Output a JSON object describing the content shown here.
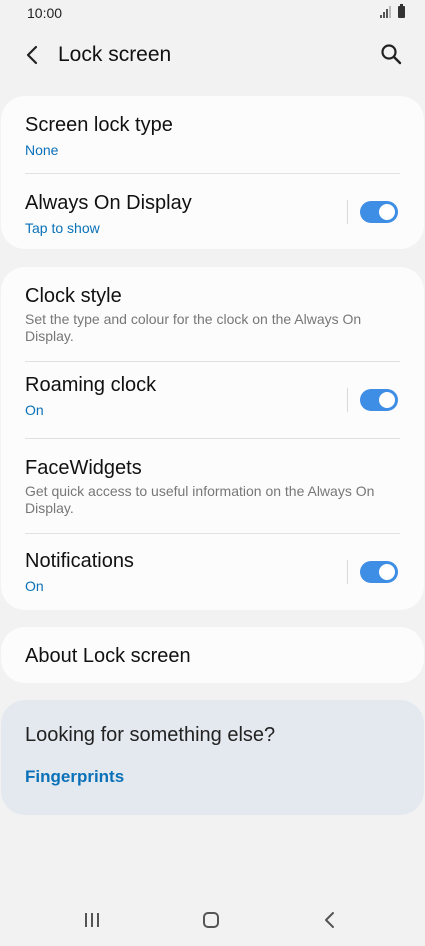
{
  "status_bar": {
    "time": "10:00",
    "icons": [
      "signal-icon",
      "battery-icon"
    ]
  },
  "header": {
    "title": "Lock screen",
    "back_icon": "back-arrow-icon",
    "search_icon": "search-icon"
  },
  "card1": {
    "items": [
      {
        "title": "Screen lock type",
        "subtitle": "None"
      },
      {
        "title": "Always On Display",
        "subtitle": "Tap to show",
        "toggle": true
      }
    ]
  },
  "card2": {
    "items": [
      {
        "title": "Clock style",
        "description": "Set the type and colour for the clock on the Always On Display."
      },
      {
        "title": "Roaming clock",
        "subtitle": "On",
        "toggle": true
      },
      {
        "title": "FaceWidgets",
        "description": "Get quick access to useful information on the Always On Display."
      },
      {
        "title": "Notifications",
        "subtitle": "On",
        "toggle": true
      }
    ]
  },
  "card3": {
    "title": "About Lock screen"
  },
  "suggestions": {
    "question": "Looking for something else?",
    "link": "Fingerprints"
  },
  "nav_bar": {
    "buttons": [
      "recent-apps-icon",
      "home-icon",
      "back-icon"
    ]
  },
  "colors": {
    "accent": "#3f8ee5",
    "link": "#0a71b8",
    "background": "#f2f2f2"
  }
}
